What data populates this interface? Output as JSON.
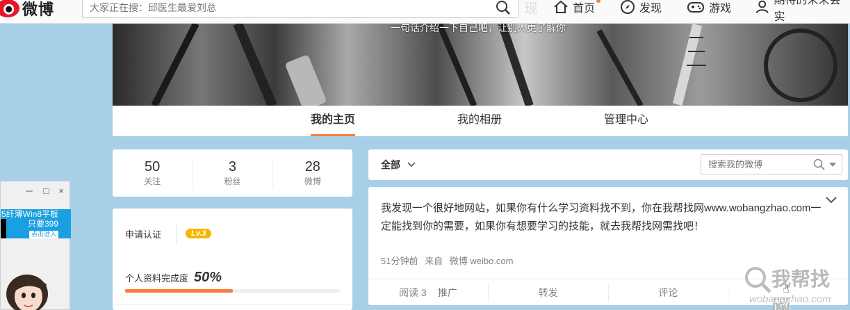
{
  "topbar": {
    "logo_text": "微博",
    "search_placeholder": "大家正在搜：邱医生最爱刘总",
    "nav_faded": "现",
    "nav": [
      {
        "label": "首页",
        "icon": "home-icon"
      },
      {
        "label": "发现",
        "icon": "compass-icon"
      },
      {
        "label": "游戏",
        "icon": "gamepad-icon"
      },
      {
        "label": "期待的未来会实",
        "icon": "user-icon"
      }
    ]
  },
  "cover": {
    "intro": "一句话介绍一下自己吧，让别人更了解你"
  },
  "tabs": [
    "我的主页",
    "我的相册",
    "管理中心"
  ],
  "stats": [
    {
      "num": "50",
      "label": "关注"
    },
    {
      "num": "3",
      "label": "粉丝"
    },
    {
      "num": "28",
      "label": "微博"
    }
  ],
  "profile": {
    "verify_label": "申请认证",
    "level": "Lv.3",
    "complete_label": "个人资料完成度",
    "complete_pct": "50%",
    "complete_value": 0.5
  },
  "feed": {
    "filter_label": "全部",
    "search_placeholder": "搜索我的微博"
  },
  "post": {
    "text": "我发现一个很好地网站，如果你有什么学习资料找不到，你在我帮找网www.wobangzhao.com一定能找到你的需要，如果你有想要学习的技能，就去我帮找网需找吧！",
    "time": "51分钟前",
    "source_prefix": "来自",
    "source": "微博 weibo.com",
    "actions": {
      "read": "阅读 3",
      "promote": "推广",
      "repost": "转发",
      "comment": "评论"
    }
  },
  "popup": {
    "ad_line1": "5纤薄Win8平板",
    "ad_line2": "只要399",
    "ad_button": "点击进入",
    "minimize": "－",
    "maximize": "□",
    "close": "×"
  },
  "watermark": {
    "main": "我帮找网",
    "sub": "wobangzhao.com"
  },
  "colors": {
    "accent": "#fa7d3c",
    "level_badge": "#f7b500",
    "background": "#a8cfe8",
    "ad_blue": "#1a9fe0"
  }
}
